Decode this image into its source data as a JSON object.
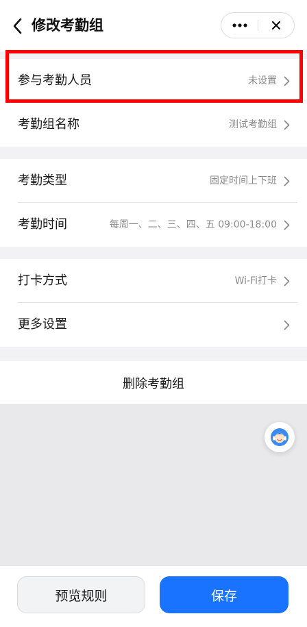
{
  "header": {
    "title": "修改考勤组",
    "back_icon": "chevron-left-icon",
    "more_icon": "more-dots-icon",
    "close_icon": "close-icon"
  },
  "groups": {
    "members": [
      {
        "label": "参与考勤人员",
        "value": "未设置",
        "highlighted": true
      },
      {
        "label": "考勤组名称",
        "value": "测试考勤组"
      }
    ],
    "schedule": [
      {
        "label": "考勤类型",
        "value": "固定时间上下班"
      },
      {
        "label": "考勤时间",
        "value": "每周一、二、三、四、五 09:00-18:00"
      }
    ],
    "other": [
      {
        "label": "打卡方式",
        "value": "Wi-Fi打卡"
      },
      {
        "label": "更多设置",
        "value": ""
      }
    ]
  },
  "delete_label": "删除考勤组",
  "service_icon": "customer-service-icon",
  "footer": {
    "preview_label": "预览规则",
    "save_label": "保存"
  },
  "colors": {
    "accent": "#1a73ff",
    "highlight": "#ff0000",
    "background": "#f2f2f4"
  }
}
